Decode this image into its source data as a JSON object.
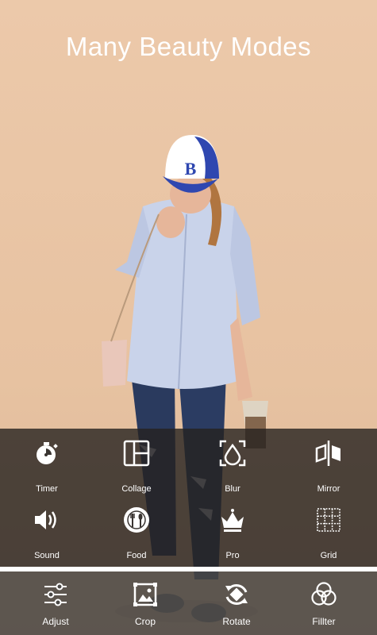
{
  "header": {
    "title": "Many Beauty Modes"
  },
  "tools": [
    {
      "label": "Timer",
      "icon": "timer-icon"
    },
    {
      "label": "Collage",
      "icon": "collage-icon"
    },
    {
      "label": "Blur",
      "icon": "blur-icon"
    },
    {
      "label": "Mirror",
      "icon": "mirror-icon"
    },
    {
      "label": "Sound",
      "icon": "sound-icon"
    },
    {
      "label": "Food",
      "icon": "food-icon"
    },
    {
      "label": "Pro",
      "icon": "crown-icon"
    },
    {
      "label": "Grid",
      "icon": "grid-icon"
    }
  ],
  "bottom_tabs": [
    {
      "label": "Adjust",
      "icon": "sliders-icon"
    },
    {
      "label": "Crop",
      "icon": "crop-icon"
    },
    {
      "label": "Rotate",
      "icon": "rotate-icon"
    },
    {
      "label": "Fillter",
      "icon": "filter-icon"
    }
  ],
  "colors": {
    "background": "#e8c4a4",
    "panel": "#26221f",
    "hat": "#2f47b0",
    "denim": "#2a3a5e",
    "shirt": "#c9d3ea"
  }
}
